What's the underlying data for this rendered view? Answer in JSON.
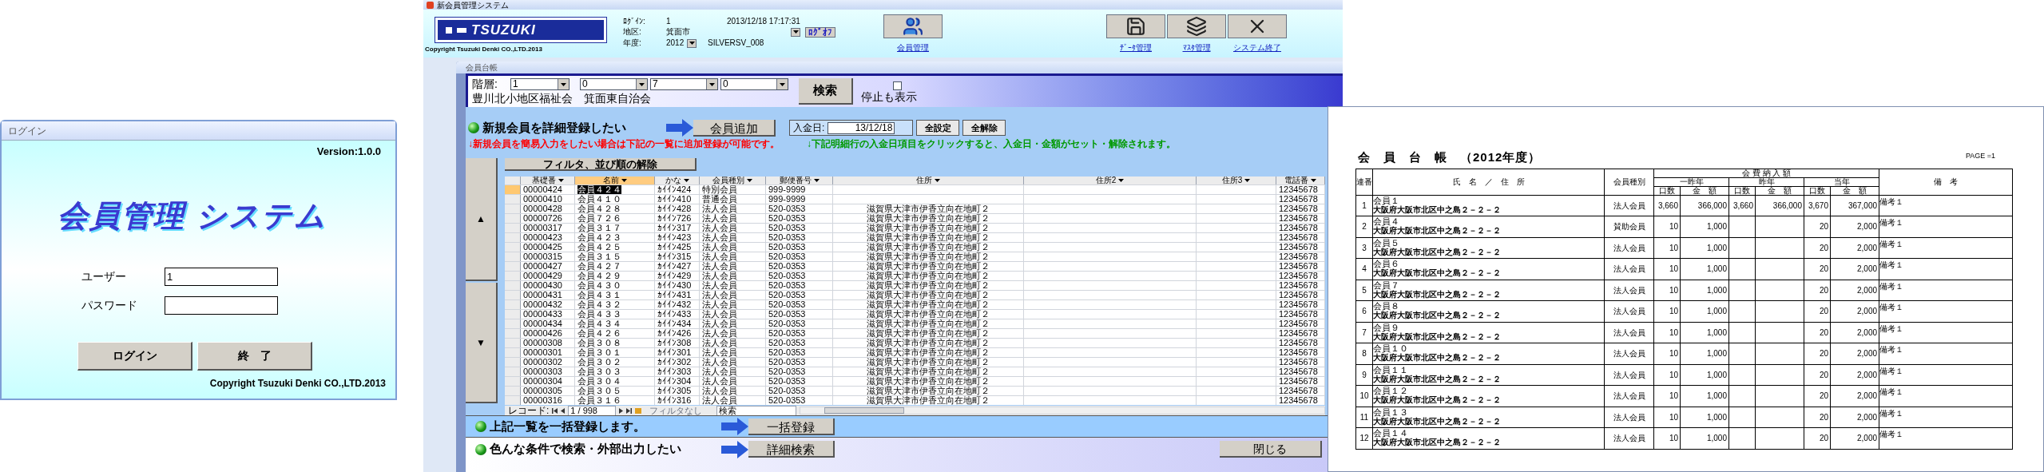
{
  "login_window": {
    "title": "ログイン",
    "version": "Version:1.0.0",
    "app_title": "会員管理 システム",
    "fields": [
      {
        "label": "ユーザー",
        "value": "1"
      },
      {
        "label": "パスワード"
      }
    ],
    "buttons": [
      "ログイン",
      "終　了"
    ],
    "copyright": "Copyright Tsuzuki Denki CO.,LTD.2013"
  },
  "main_window": {
    "title": "新会員管理システム",
    "header": {
      "logo": "TSUZUKI",
      "copyright": "Copyright Tsuzuki Denki CO.,LTD.2013",
      "login_label": "ﾛｸﾞｲﾝ:",
      "login_value": "1",
      "datetime": "2013/12/18 17:17:31",
      "district_label": "地区:",
      "district_value": "箕面市",
      "logoff_button": "ﾛｸﾞｵﾌ",
      "year_label": "年度:",
      "year_value": "2012",
      "server": "SILVERSV_008",
      "nav_buttons": [
        {
          "label": "会員管理",
          "kind": "people"
        },
        {
          "label": "ﾃﾞｰﾀ管理",
          "kind": "disk"
        },
        {
          "label": "ﾏｽﾀ管理",
          "kind": "stack"
        },
        {
          "label": "システム終了",
          "kind": "close"
        }
      ]
    },
    "subwindow": {
      "title": "会員台帳",
      "filter": {
        "label": "階層:",
        "dropdowns": [
          "1",
          "0",
          "7",
          "0"
        ],
        "org_text": "豊川北小地区福祉会　箕面東自治会",
        "search_button": "検索",
        "checkbox": {
          "label": "停止も表示",
          "checked": false
        }
      },
      "action": {
        "text": "新規会員を詳細登録したい",
        "button": "会員追加",
        "payment_label": "入金日:",
        "payment_date": "13/12/18",
        "buttons": [
          "全設定",
          "全解除"
        ]
      },
      "notes": [
        {
          "text": "↓新規会員を簡易入力をしたい場合は下記の一覧に追加登録が可能です。",
          "color": "#ff0000"
        },
        {
          "text": "↓下記明細行の入金日項目をクリックすると、入金日・金額がセット・解除されます。",
          "color": "#009900"
        }
      ],
      "grid": {
        "reset_button": "フィルタ、並び順の解除",
        "up_button": "▲",
        "down_button": "▼",
        "columns": [
          {
            "label": "基礎番",
            "selected": false
          },
          {
            "label": "名前",
            "selected": true
          },
          {
            "label": "かな",
            "selected": false
          },
          {
            "label": "会員種別",
            "selected": false
          },
          {
            "label": "郵便番号",
            "selected": false
          },
          {
            "label": "住所",
            "selected": false
          },
          {
            "label": "住所2",
            "selected": false
          },
          {
            "label": "住所3",
            "selected": false
          },
          {
            "label": "電話番",
            "selected": false
          }
        ],
        "rows": [
          {
            "id": "00000424",
            "name": "会員４２４",
            "kana": "ｶｲｲﾝ424",
            "type": "特別会員",
            "zip": "999-9999",
            "phone": "12345678",
            "selected": true
          },
          {
            "id": "00000410",
            "name": "会員４１０",
            "kana": "ｶｲｲﾝ410",
            "type": "普通会員",
            "zip": "999-9999",
            "phone": "12345678",
            "selected": false
          },
          {
            "id": "00000428",
            "name": "会員４２８",
            "kana": "ｶｲｲﾝ428",
            "type": "法人会員",
            "zip": "520-0353",
            "address": "滋賀県大津市伊香立向在地町２",
            "phone": "12345678",
            "selected": false
          },
          {
            "id": "00000726",
            "name": "会員７２６",
            "kana": "ｶｲｲﾝ726",
            "type": "法人会員",
            "zip": "520-0353",
            "address": "滋賀県大津市伊香立向在地町２",
            "phone": "12345678",
            "selected": false
          },
          {
            "id": "00000317",
            "name": "会員３１７",
            "kana": "ｶｲｲﾝ317",
            "type": "法人会員",
            "zip": "520-0353",
            "address": "滋賀県大津市伊香立向在地町２",
            "phone": "12345678",
            "selected": false
          },
          {
            "id": "00000423",
            "name": "会員４２３",
            "kana": "ｶｲｲﾝ423",
            "type": "法人会員",
            "zip": "520-0353",
            "address": "滋賀県大津市伊香立向在地町２",
            "phone": "12345678",
            "selected": false
          },
          {
            "id": "00000425",
            "name": "会員４２５",
            "kana": "ｶｲｲﾝ425",
            "type": "法人会員",
            "zip": "520-0353",
            "address": "滋賀県大津市伊香立向在地町２",
            "phone": "12345678",
            "selected": false
          },
          {
            "id": "00000315",
            "name": "会員３１５",
            "kana": "ｶｲｲﾝ315",
            "type": "法人会員",
            "zip": "520-0353",
            "address": "滋賀県大津市伊香立向在地町２",
            "phone": "12345678",
            "selected": false
          },
          {
            "id": "00000427",
            "name": "会員４２７",
            "kana": "ｶｲｲﾝ427",
            "type": "法人会員",
            "zip": "520-0353",
            "address": "滋賀県大津市伊香立向在地町２",
            "phone": "12345678",
            "selected": false
          },
          {
            "id": "00000429",
            "name": "会員４２９",
            "kana": "ｶｲｲﾝ429",
            "type": "法人会員",
            "zip": "520-0353",
            "address": "滋賀県大津市伊香立向在地町２",
            "phone": "12345678",
            "selected": false
          },
          {
            "id": "00000430",
            "name": "会員４３０",
            "kana": "ｶｲｲﾝ430",
            "type": "法人会員",
            "zip": "520-0353",
            "address": "滋賀県大津市伊香立向在地町２",
            "phone": "12345678",
            "selected": false
          },
          {
            "id": "00000431",
            "name": "会員４３１",
            "kana": "ｶｲｲﾝ431",
            "type": "法人会員",
            "zip": "520-0353",
            "address": "滋賀県大津市伊香立向在地町２",
            "phone": "12345678",
            "selected": false
          },
          {
            "id": "00000432",
            "name": "会員４３２",
            "kana": "ｶｲｲﾝ432",
            "type": "法人会員",
            "zip": "520-0353",
            "address": "滋賀県大津市伊香立向在地町２",
            "phone": "12345678",
            "selected": false
          },
          {
            "id": "00000433",
            "name": "会員４３３",
            "kana": "ｶｲｲﾝ433",
            "type": "法人会員",
            "zip": "520-0353",
            "address": "滋賀県大津市伊香立向在地町２",
            "phone": "12345678",
            "selected": false
          },
          {
            "id": "00000434",
            "name": "会員４３４",
            "kana": "ｶｲｲﾝ434",
            "type": "法人会員",
            "zip": "520-0353",
            "address": "滋賀県大津市伊香立向在地町２",
            "phone": "12345678",
            "selected": false
          },
          {
            "id": "00000426",
            "name": "会員４２６",
            "kana": "ｶｲｲﾝ426",
            "type": "法人会員",
            "zip": "520-0353",
            "address": "滋賀県大津市伊香立向在地町２",
            "phone": "12345678",
            "selected": false
          },
          {
            "id": "00000308",
            "name": "会員３０８",
            "kana": "ｶｲｲﾝ308",
            "type": "法人会員",
            "zip": "520-0353",
            "address": "滋賀県大津市伊香立向在地町２",
            "phone": "12345678",
            "selected": false
          },
          {
            "id": "00000301",
            "name": "会員３０１",
            "kana": "ｶｲｲﾝ301",
            "type": "法人会員",
            "zip": "520-0353",
            "address": "滋賀県大津市伊香立向在地町２",
            "phone": "12345678",
            "selected": false
          },
          {
            "id": "00000302",
            "name": "会員３０２",
            "kana": "ｶｲｲﾝ302",
            "type": "法人会員",
            "zip": "520-0353",
            "address": "滋賀県大津市伊香立向在地町２",
            "phone": "12345678",
            "selected": false
          },
          {
            "id": "00000303",
            "name": "会員３０３",
            "kana": "ｶｲｲﾝ303",
            "type": "法人会員",
            "zip": "520-0353",
            "address": "滋賀県大津市伊香立向在地町２",
            "phone": "12345678",
            "selected": false
          },
          {
            "id": "00000304",
            "name": "会員３０４",
            "kana": "ｶｲｲﾝ304",
            "type": "法人会員",
            "zip": "520-0353",
            "address": "滋賀県大津市伊香立向在地町２",
            "phone": "12345678",
            "selected": false
          },
          {
            "id": "00000305",
            "name": "会員３０５",
            "kana": "ｶｲｲﾝ305",
            "type": "法人会員",
            "zip": "520-0353",
            "address": "滋賀県大津市伊香立向在地町２",
            "phone": "12345678",
            "selected": false
          },
          {
            "id": "00000316",
            "name": "会員３１６",
            "kana": "ｶｲｲﾝ316",
            "type": "法人会員",
            "zip": "520-0353",
            "address": "滋賀県大津市伊香立向在地町２",
            "phone": "12345678",
            "selected": false
          }
        ],
        "navigation": {
          "label": "レコード:",
          "position": "1 / 998",
          "filter": "フィルタなし",
          "search": "検索"
        }
      },
      "bars": [
        {
          "text": "上記一覧を一括登録します。",
          "button": "一括登録"
        },
        {
          "text": "色んな条件で検索・外部出力したい",
          "button": "詳細検索",
          "close_button": "閉じる"
        }
      ]
    }
  },
  "report": {
    "title": "会　員　台　帳　（2012年度）",
    "page": "PAGE =1",
    "headers": {
      "no": "連番",
      "name": "氏　名　／　住　所",
      "type": "会員種別",
      "fees": "会 費 納 入 額",
      "years": [
        "一昨年",
        "昨年",
        "当年"
      ],
      "sub": [
        "口数",
        "金　額",
        "口数",
        "金　額",
        "口数",
        "金　額"
      ],
      "remarks": "備　考"
    },
    "rows": [
      {
        "no": "1",
        "name": "会員１",
        "address": "大阪府大阪市北区中之島２－２－２",
        "type": "法人会員",
        "prev2": {
          "count": "3,660",
          "amount": "366,000"
        },
        "prev1": {
          "count": "3,660",
          "amount": "366,000"
        },
        "current": {
          "count": "3,670",
          "amount": "367,000"
        },
        "remarks": "備考１"
      },
      {
        "no": "2",
        "name": "会員４",
        "address": "大阪府大阪市北区中之島２－２－２",
        "type": "賛助会員",
        "prev2": {
          "count": "10",
          "amount": "1,000"
        },
        "current": {
          "count": "20",
          "amount": "2,000"
        },
        "remarks": "備考１"
      },
      {
        "no": "3",
        "name": "会員５",
        "address": "大阪府大阪市北区中之島２－２－２",
        "type": "法人会員",
        "prev2": {
          "count": "10",
          "amount": "1,000"
        },
        "current": {
          "count": "20",
          "amount": "2,000"
        },
        "remarks": "備考１"
      },
      {
        "no": "4",
        "name": "会員６",
        "address": "大阪府大阪市北区中之島２－２－２",
        "type": "法人会員",
        "prev2": {
          "count": "10",
          "amount": "1,000"
        },
        "current": {
          "count": "20",
          "amount": "2,000"
        },
        "remarks": "備考１"
      },
      {
        "no": "5",
        "name": "会員７",
        "address": "大阪府大阪市北区中之島２－２－２",
        "type": "法人会員",
        "prev2": {
          "count": "10",
          "amount": "1,000"
        },
        "current": {
          "count": "20",
          "amount": "2,000"
        },
        "remarks": "備考１"
      },
      {
        "no": "6",
        "name": "会員８",
        "address": "大阪府大阪市北区中之島２－２－２",
        "type": "法人会員",
        "prev2": {
          "count": "10",
          "amount": "1,000"
        },
        "current": {
          "count": "20",
          "amount": "2,000"
        },
        "remarks": "備考１"
      },
      {
        "no": "7",
        "name": "会員９",
        "address": "大阪府大阪市北区中之島２－２－２",
        "type": "法人会員",
        "prev2": {
          "count": "10",
          "amount": "1,000"
        },
        "current": {
          "count": "20",
          "amount": "2,000"
        },
        "remarks": "備考１"
      },
      {
        "no": "8",
        "name": "会員１０",
        "address": "大阪府大阪市北区中之島２－２－２",
        "type": "法人会員",
        "prev2": {
          "count": "10",
          "amount": "1,000"
        },
        "current": {
          "count": "20",
          "amount": "2,000"
        },
        "remarks": "備考１"
      },
      {
        "no": "9",
        "name": "会員１１",
        "address": "大阪府大阪市北区中之島２－２－２",
        "type": "法人会員",
        "prev2": {
          "count": "10",
          "amount": "1,000"
        },
        "current": {
          "count": "20",
          "amount": "2,000"
        },
        "remarks": "備考１"
      },
      {
        "no": "10",
        "name": "会員１２",
        "address": "大阪府大阪市北区中之島２－２－２",
        "type": "法人会員",
        "prev2": {
          "count": "10",
          "amount": "1,000"
        },
        "current": {
          "count": "20",
          "amount": "2,000"
        },
        "remarks": "備考１"
      },
      {
        "no": "11",
        "name": "会員１３",
        "address": "大阪府大阪市北区中之島２－２－２",
        "type": "法人会員",
        "prev2": {
          "count": "10",
          "amount": "1,000"
        },
        "current": {
          "count": "20",
          "amount": "2,000"
        },
        "remarks": "備考１"
      },
      {
        "no": "12",
        "name": "会員１４",
        "address": "大阪府大阪市北区中之島２－２－２",
        "type": "法人会員",
        "prev2": {
          "count": "10",
          "amount": "1,000"
        },
        "current": {
          "count": "20",
          "amount": "2,000"
        },
        "remarks": "備考１"
      }
    ]
  }
}
